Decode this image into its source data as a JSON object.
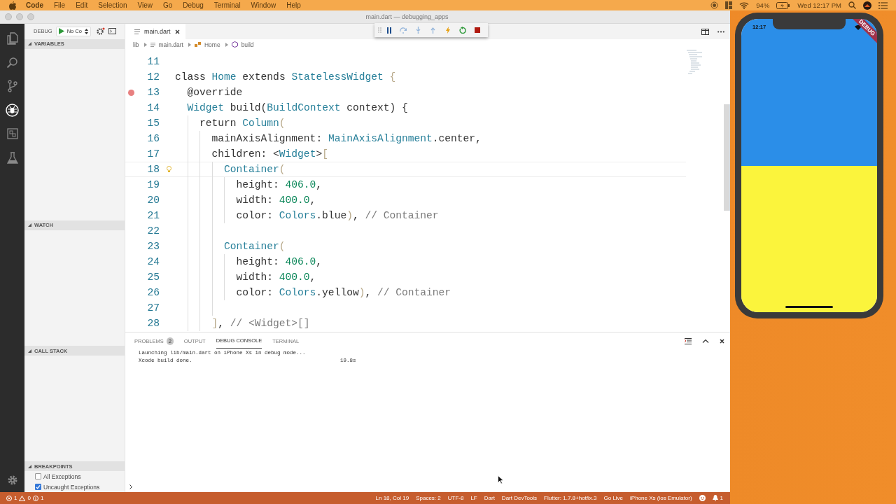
{
  "menu_bar": {
    "app": "Code",
    "items": [
      "File",
      "Edit",
      "Selection",
      "View",
      "Go",
      "Debug",
      "Terminal",
      "Window",
      "Help"
    ],
    "battery": "94%",
    "clock": "Wed 12:17 PM"
  },
  "window": {
    "title": "main.dart — debugging_apps"
  },
  "activity_bar": [
    {
      "kind": "files",
      "selected": false
    },
    {
      "kind": "search",
      "selected": false
    },
    {
      "kind": "source-control",
      "selected": false
    },
    {
      "kind": "debug",
      "selected": true
    },
    {
      "kind": "extensions",
      "selected": false
    },
    {
      "kind": "test",
      "selected": false
    }
  ],
  "debug_sidebar": {
    "label": "DEBUG",
    "configuration": "No Co",
    "sections": [
      {
        "title": "VARIABLES",
        "expanded": true
      },
      {
        "title": "WATCH",
        "expanded": true
      },
      {
        "title": "CALL STACK",
        "expanded": true
      },
      {
        "title": "BREAKPOINTS",
        "expanded": true,
        "items": [
          {
            "label": "All Exceptions",
            "checked": false
          },
          {
            "label": "Uncaught Exceptions",
            "checked": true
          }
        ]
      }
    ]
  },
  "debug_toolbar": [
    {
      "kind": "pause",
      "disabled": false
    },
    {
      "kind": "step-over",
      "disabled": true
    },
    {
      "kind": "step-into",
      "disabled": true
    },
    {
      "kind": "step-out",
      "disabled": true
    },
    {
      "kind": "hot-reload",
      "disabled": false
    },
    {
      "kind": "restart",
      "disabled": false
    },
    {
      "kind": "stop",
      "disabled": false
    }
  ],
  "editor": {
    "tab": {
      "label": "main.dart",
      "selected": true
    },
    "breadcrumbs": [
      {
        "kind": "folder",
        "text": "lib"
      },
      {
        "kind": "file",
        "text": "main.dart"
      },
      {
        "kind": "class",
        "text": "Home"
      },
      {
        "kind": "method",
        "text": "build"
      }
    ],
    "lines": [
      {
        "number": "11"
      },
      {
        "number": "12",
        "tokens": [
          {
            "kind": "plain",
            "text": "class "
          },
          {
            "kind": "type",
            "text": "Home"
          },
          {
            "kind": "plain",
            "text": " extends "
          },
          {
            "kind": "type",
            "text": "StatelessWidget"
          },
          {
            "kind": "bracket",
            "text": " {"
          }
        ],
        "children": [
          {
            "number": "13",
            "breakpoint": true,
            "tokens": [
              {
                "kind": "plain",
                "text": "@override"
              }
            ]
          },
          {
            "number": "14",
            "tokens": [
              {
                "kind": "type",
                "text": "Widget"
              },
              {
                "kind": "plain",
                "text": " build("
              },
              {
                "kind": "type",
                "text": "BuildContext"
              },
              {
                "kind": "plain",
                "text": " context) {"
              }
            ],
            "children": [
              {
                "number": "15",
                "tokens": [
                  {
                    "kind": "plain",
                    "text": "return "
                  },
                  {
                    "kind": "type",
                    "text": "Column"
                  },
                  {
                    "kind": "bracket",
                    "text": "("
                  }
                ],
                "children": [
                  {
                    "number": "16",
                    "tokens": [
                      {
                        "kind": "plain",
                        "text": "mainAxisAlignment: "
                      },
                      {
                        "kind": "type",
                        "text": "MainAxisAlignment"
                      },
                      {
                        "kind": "plain",
                        "text": ".center,"
                      }
                    ]
                  },
                  {
                    "number": "17",
                    "tokens": [
                      {
                        "kind": "plain",
                        "text": "children: <"
                      },
                      {
                        "kind": "type",
                        "text": "Widget"
                      },
                      {
                        "kind": "plain",
                        "text": ">"
                      },
                      {
                        "kind": "bracket",
                        "text": "["
                      }
                    ],
                    "children": [
                      {
                        "number": "18",
                        "lightbulb": true,
                        "current": true,
                        "tokens": [
                          {
                            "kind": "type",
                            "text": "Container"
                          },
                          {
                            "kind": "bracket",
                            "text": "("
                          }
                        ],
                        "children": [
                          {
                            "number": "19",
                            "tokens": [
                              {
                                "kind": "plain",
                                "text": "height: "
                              },
                              {
                                "kind": "number",
                                "text": "406.0"
                              },
                              {
                                "kind": "plain",
                                "text": ","
                              }
                            ]
                          },
                          {
                            "number": "20",
                            "tokens": [
                              {
                                "kind": "plain",
                                "text": "width: "
                              },
                              {
                                "kind": "number",
                                "text": "400.0"
                              },
                              {
                                "kind": "plain",
                                "text": ","
                              }
                            ]
                          },
                          {
                            "number": "21",
                            "tokens": [
                              {
                                "kind": "plain",
                                "text": "color: "
                              },
                              {
                                "kind": "type",
                                "text": "Colors"
                              },
                              {
                                "kind": "plain",
                                "text": ".blue"
                              },
                              {
                                "kind": "bracket",
                                "text": ")"
                              },
                              {
                                "kind": "plain",
                                "text": ", "
                              },
                              {
                                "kind": "comment",
                                "text": "// Container"
                              }
                            ]
                          }
                        ]
                      },
                      {
                        "number": "22"
                      },
                      {
                        "number": "23",
                        "tokens": [
                          {
                            "kind": "type",
                            "text": "Container"
                          },
                          {
                            "kind": "bracket",
                            "text": "("
                          }
                        ],
                        "children": [
                          {
                            "number": "24",
                            "tokens": [
                              {
                                "kind": "plain",
                                "text": "height: "
                              },
                              {
                                "kind": "number",
                                "text": "406.0"
                              },
                              {
                                "kind": "plain",
                                "text": ","
                              }
                            ]
                          },
                          {
                            "number": "25",
                            "tokens": [
                              {
                                "kind": "plain",
                                "text": "width: "
                              },
                              {
                                "kind": "number",
                                "text": "400.0"
                              },
                              {
                                "kind": "plain",
                                "text": ","
                              }
                            ]
                          },
                          {
                            "number": "26",
                            "tokens": [
                              {
                                "kind": "plain",
                                "text": "color: "
                              },
                              {
                                "kind": "type",
                                "text": "Colors"
                              },
                              {
                                "kind": "plain",
                                "text": ".yellow"
                              },
                              {
                                "kind": "bracket",
                                "text": ")"
                              },
                              {
                                "kind": "plain",
                                "text": ", "
                              },
                              {
                                "kind": "comment",
                                "text": "// Container"
                              }
                            ]
                          }
                        ]
                      },
                      {
                        "number": "27"
                      }
                    ]
                  },
                  {
                    "number": "28",
                    "tokens": [
                      {
                        "kind": "bracket",
                        "text": "]"
                      },
                      {
                        "kind": "plain",
                        "text": ", "
                      },
                      {
                        "kind": "comment",
                        "text": "// <Widget>[]"
                      }
                    ]
                  }
                ]
              }
            ]
          }
        ]
      }
    ]
  },
  "panel": {
    "tabs": [
      {
        "label": "PROBLEMS",
        "badge": "2",
        "selected": false
      },
      {
        "label": "OUTPUT",
        "selected": false
      },
      {
        "label": "DEBUG CONSOLE",
        "selected": true
      },
      {
        "label": "TERMINAL",
        "selected": false
      }
    ],
    "console": [
      {
        "text": "Launching lib/main.dart on iPhone Xs in debug mode..."
      },
      {
        "text": "Xcode build done.",
        "time": "19.8s"
      }
    ]
  },
  "status_bar": {
    "errors": "1",
    "warnings": "0",
    "infos": "1",
    "items": [
      "Ln 18, Col 19",
      "Spaces: 2",
      "UTF-8",
      "LF",
      "Dart",
      "Dart DevTools",
      "Flutter: 1.7.8+hotfix.3",
      "Go Live",
      "iPhone Xs (ios Emulator)"
    ],
    "notifications": "1"
  },
  "simulator": {
    "time": "12:17",
    "banner": "DEBUG",
    "sections": [
      {
        "color": "#2b8ee8"
      },
      {
        "color": "#fbf43c"
      }
    ]
  }
}
